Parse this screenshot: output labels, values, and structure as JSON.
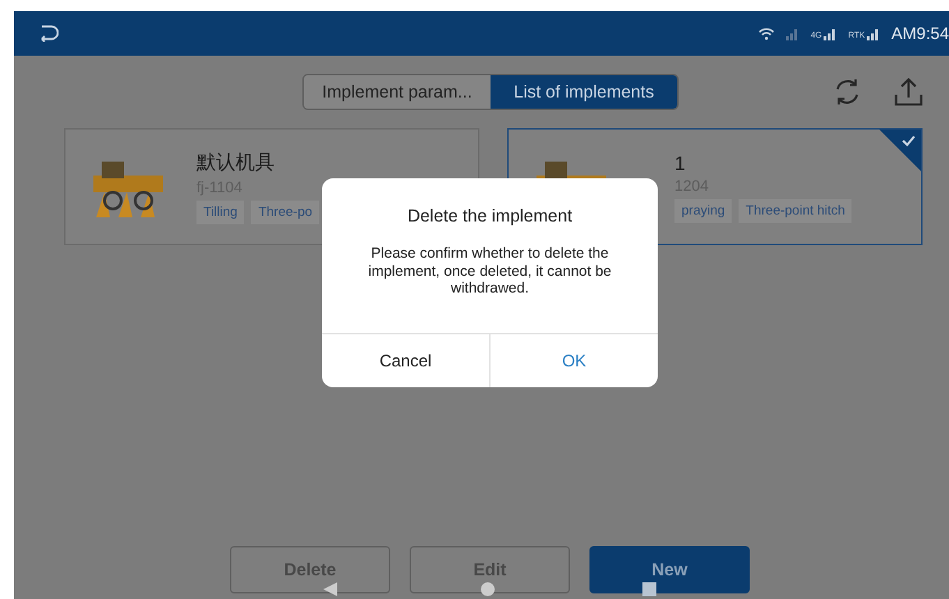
{
  "status_bar": {
    "indicators": [
      {
        "kind": "wifi"
      },
      {
        "kind": "signal"
      },
      {
        "kind": "signal",
        "label": "4G"
      },
      {
        "kind": "signal",
        "label": "RTK"
      }
    ],
    "time": "AM9:54"
  },
  "tabs": [
    {
      "label": "Implement param...",
      "selected": false
    },
    {
      "label": "List of implements",
      "selected": true
    }
  ],
  "implements": [
    {
      "name": "默认机具",
      "model": "fj-1104",
      "tags": [
        "Tilling",
        "Three-po"
      ],
      "selected": false
    },
    {
      "name": "1",
      "model": "1204",
      "tags": [
        "praying",
        "Three-point hitch"
      ],
      "selected": true
    }
  ],
  "dialog": {
    "title": "Delete the implement",
    "message": "Please confirm whether to delete the implement, once deleted, it cannot be withdrawed.",
    "buttons": [
      {
        "label": "Cancel",
        "kind": "cancel"
      },
      {
        "label": "OK",
        "kind": "confirm"
      }
    ]
  },
  "actions": [
    {
      "label": "Delete",
      "kind": "secondary"
    },
    {
      "label": "Edit",
      "kind": "secondary"
    },
    {
      "label": "New",
      "kind": "primary"
    }
  ]
}
